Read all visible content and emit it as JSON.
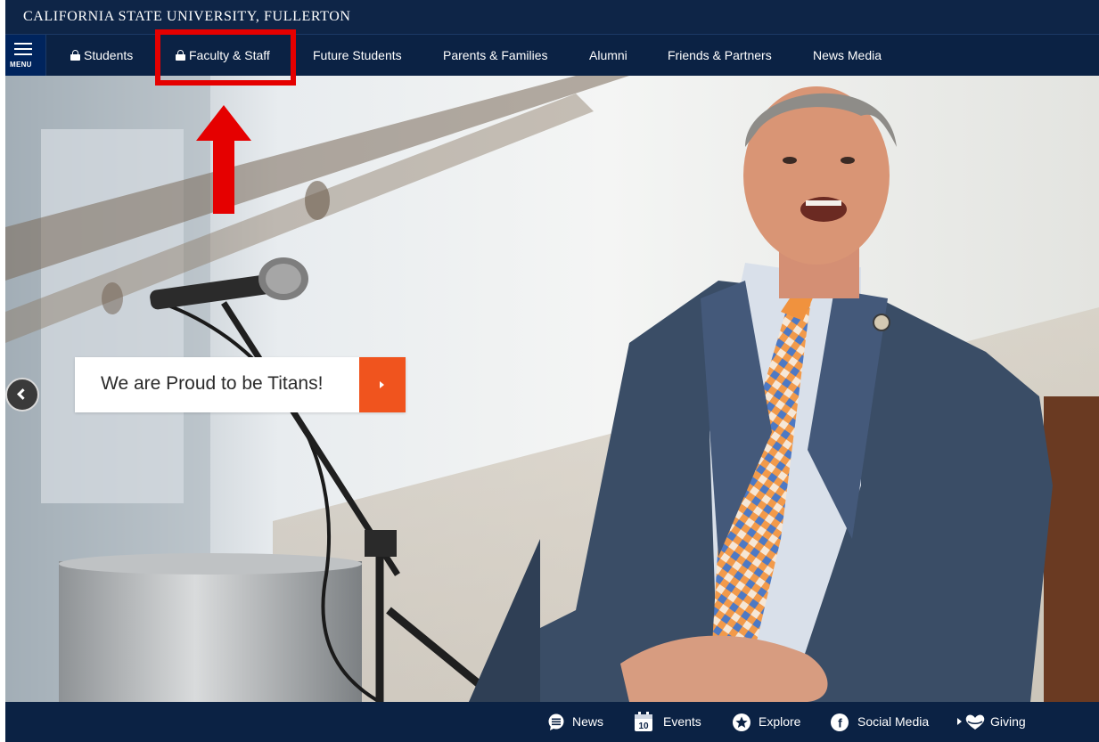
{
  "header": {
    "brand": "CALIFORNIA STATE UNIVERSITY, FULLERTON"
  },
  "nav": {
    "menu_label": "MENU",
    "items": [
      {
        "label": "Students",
        "locked": true
      },
      {
        "label": "Faculty & Staff",
        "locked": true
      },
      {
        "label": "Future Students",
        "locked": false
      },
      {
        "label": "Parents & Families",
        "locked": false
      },
      {
        "label": "Alumni",
        "locked": false
      },
      {
        "label": "Friends & Partners",
        "locked": false
      },
      {
        "label": "News Media",
        "locked": false
      }
    ]
  },
  "hero": {
    "caption": "We are Proud to be Titans!"
  },
  "footer": {
    "items": [
      {
        "label": "News",
        "icon": "comment-icon"
      },
      {
        "label": "Events",
        "icon": "calendar-icon",
        "icon_text": "10"
      },
      {
        "label": "Explore",
        "icon": "star-icon"
      },
      {
        "label": "Social Media",
        "icon": "facebook-icon",
        "icon_text": "f"
      },
      {
        "label": "Giving",
        "icon": "heart-icon"
      }
    ]
  },
  "annotation": {
    "highlight_target": "Faculty & Staff",
    "color": "#e50000"
  },
  "colors": {
    "navy": "#0b2244",
    "accent_orange": "#f0541e"
  }
}
